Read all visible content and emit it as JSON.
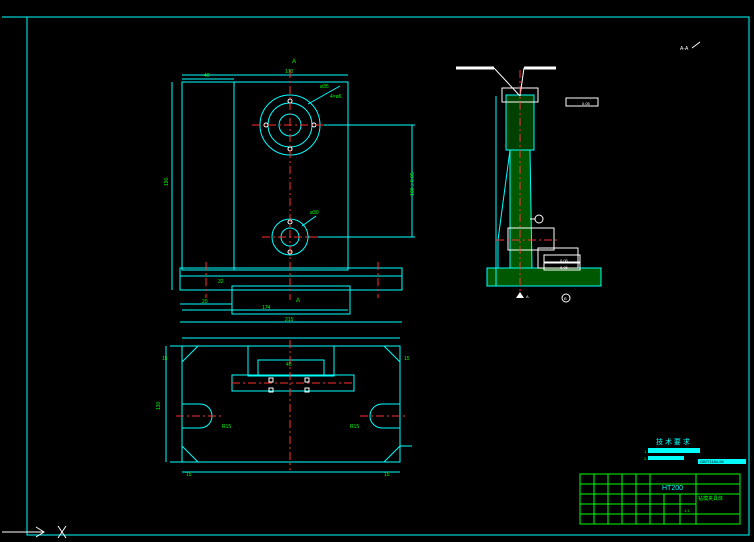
{
  "drawing": {
    "annotation_mark": "A-A",
    "front_view": {
      "top_width": "170",
      "left_offset": "40",
      "overall_width": "215",
      "base_width": "174",
      "bottom_left": "20",
      "total_height": "190",
      "height_right": "160 ± 0.05",
      "section_marker": "A",
      "small_left": "32",
      "upper_hole_label": "ø35",
      "lower_hole_label": "ø30",
      "hole_note": "4×ø6"
    },
    "plan_view": {
      "left_height": "130",
      "hole_left": "R15",
      "hole_right": "R15",
      "corner_bl": "15",
      "corner_br": "15",
      "corner_tl": "15",
      "corner_tr": "15",
      "center_mark": "40"
    },
    "side_view": {
      "tol_box_1": "0.05",
      "tol_box_2": "0.05",
      "tol_box_3": "0.05",
      "datum_a": "A",
      "datum_b": "B"
    },
    "tech_req": {
      "title": "技 术 要 求",
      "line1": "1.",
      "line2": "2.",
      "note": "GB/T1184-96"
    },
    "title_block": {
      "material": "HT200",
      "part_name": "钻模夹具体",
      "scale_label": "1:1"
    }
  },
  "colors": {
    "border": "#00ffff",
    "lines": "#00ffff",
    "text": "#00ff00",
    "hatch": "#00ff00",
    "center": "#ff3030",
    "white": "#ffffff",
    "tech_bar": "#00ffff"
  }
}
